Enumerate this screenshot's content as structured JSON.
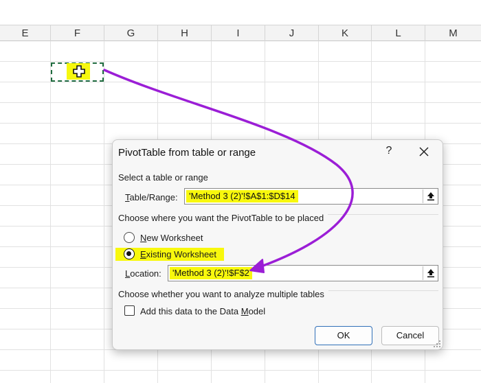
{
  "sheet": {
    "columns": [
      "E",
      "F",
      "G",
      "H",
      "I",
      "J",
      "K",
      "L",
      "M"
    ]
  },
  "dialog": {
    "title": "PivotTable from table or range",
    "help": "?",
    "section1": "Select a table or range",
    "table_range": {
      "label_pre": "",
      "label_u": "T",
      "label_post": "able/Range:",
      "value": "'Method 3 (2)'!$A$1:$D$14"
    },
    "section2": "Choose where you want the PivotTable to be placed",
    "new_ws": {
      "label_u": "N",
      "label_post": "ew Worksheet"
    },
    "existing_ws": {
      "label_u": "E",
      "label_post": "xisting Worksheet"
    },
    "location": {
      "label_u": "L",
      "label_post": "ocation:",
      "value": "'Method 3 (2)'!$F$2"
    },
    "section3": "Choose whether you want to analyze multiple tables",
    "data_model": {
      "label_pre": "Add this data to the Data ",
      "label_u": "M",
      "label_post": "odel"
    },
    "ok": "OK",
    "cancel": "Cancel"
  },
  "colors": {
    "highlight": "#f8f80d",
    "annotation_arrow": "#9b1ed6",
    "marquee": "#1e6b3e",
    "ok_border": "#2f6fb8"
  },
  "icons": [
    "move-cursor-icon",
    "close-icon",
    "collapse-dialog-icon",
    "resize-grip-icon"
  ]
}
